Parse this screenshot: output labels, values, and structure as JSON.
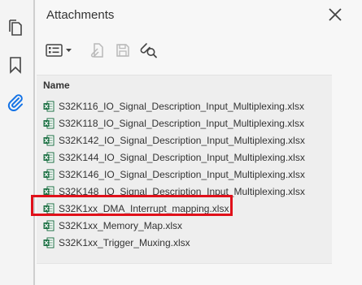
{
  "panel": {
    "title": "Attachments",
    "column_header": "Name"
  },
  "rail": {
    "items": [
      {
        "icon": "copy-pages-icon"
      },
      {
        "icon": "bookmark-icon"
      },
      {
        "icon": "paperclip-icon",
        "active": true
      }
    ]
  },
  "toolbar": {
    "items": [
      {
        "icon": "options-menu-icon",
        "enabled": true
      },
      {
        "icon": "attach-file-icon",
        "enabled": false
      },
      {
        "icon": "save-icon",
        "enabled": false
      },
      {
        "icon": "search-attachments-icon",
        "enabled": true
      }
    ]
  },
  "files": [
    {
      "name": "S32K116_IO_Signal_Description_Input_Multiplexing.xlsx"
    },
    {
      "name": "S32K118_IO_Signal_Description_Input_Multiplexing.xlsx"
    },
    {
      "name": "S32K142_IO_Signal_Description_Input_Multiplexing.xlsx"
    },
    {
      "name": "S32K144_IO_Signal_Description_Input_Multiplexing.xlsx"
    },
    {
      "name": "S32K146_IO_Signal_Description_Input_Multiplexing.xlsx"
    },
    {
      "name": "S32K148_IO_Signal_Description_Input_Multiplexing.xlsx"
    },
    {
      "name": "S32K1xx_DMA_Interrupt_mapping.xlsx",
      "highlighted": true
    },
    {
      "name": "S32K1xx_Memory_Map.xlsx"
    },
    {
      "name": "S32K1xx_Trigger_Muxing.xlsx"
    }
  ],
  "colors": {
    "accent": "#1473e6",
    "highlight_border": "#e0101a",
    "excel_green": "#1d7044"
  }
}
